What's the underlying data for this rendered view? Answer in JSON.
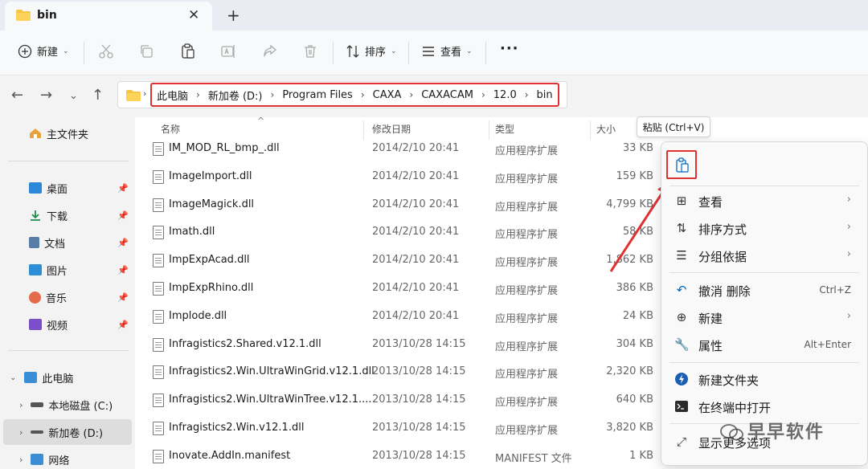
{
  "tab": {
    "title": "bin"
  },
  "toolbar": {
    "new_label": "新建",
    "sort_label": "排序",
    "view_label": "查看",
    "more_label": "···"
  },
  "address": {
    "crumbs": [
      "此电脑",
      "新加卷 (D:)",
      "Program Files",
      "CAXA",
      "CAXACAM",
      "12.0",
      "bin"
    ]
  },
  "sidebar": {
    "home": "主文件夹",
    "quick": [
      {
        "label": "桌面",
        "color": "#2b88d8"
      },
      {
        "label": "下载",
        "color": "#1e8f4a"
      },
      {
        "label": "文档",
        "color": "#5a7da8"
      },
      {
        "label": "图片",
        "color": "#2e8fd9"
      },
      {
        "label": "音乐",
        "color": "#e36b4a"
      },
      {
        "label": "视频",
        "color": "#7b4fc9"
      }
    ],
    "this_pc": "此电脑",
    "drives": [
      "本地磁盘 (C:)",
      "新加卷 (D:)"
    ],
    "network": "网络"
  },
  "columns": {
    "name": "名称",
    "date": "修改日期",
    "type": "类型",
    "size": "大小"
  },
  "files": [
    {
      "name": "IM_MOD_RL_bmp_.dll",
      "date": "2014/2/10 20:41",
      "type": "应用程序扩展",
      "size": "33 KB"
    },
    {
      "name": "ImageImport.dll",
      "date": "2014/2/10 20:41",
      "type": "应用程序扩展",
      "size": "159 KB"
    },
    {
      "name": "ImageMagick.dll",
      "date": "2014/2/10 20:41",
      "type": "应用程序扩展",
      "size": "4,799 KB"
    },
    {
      "name": "Imath.dll",
      "date": "2014/2/10 20:41",
      "type": "应用程序扩展",
      "size": "58 KB"
    },
    {
      "name": "ImpExpAcad.dll",
      "date": "2014/2/10 20:41",
      "type": "应用程序扩展",
      "size": "1,862 KB"
    },
    {
      "name": "ImpExpRhino.dll",
      "date": "2014/2/10 20:41",
      "type": "应用程序扩展",
      "size": "386 KB"
    },
    {
      "name": "Implode.dll",
      "date": "2014/2/10 20:41",
      "type": "应用程序扩展",
      "size": "24 KB"
    },
    {
      "name": "Infragistics2.Shared.v12.1.dll",
      "date": "2013/10/28 14:15",
      "type": "应用程序扩展",
      "size": "304 KB"
    },
    {
      "name": "Infragistics2.Win.UltraWinGrid.v12.1.dll",
      "date": "2013/10/28 14:15",
      "type": "应用程序扩展",
      "size": "2,320 KB"
    },
    {
      "name": "Infragistics2.Win.UltraWinTree.v12.1....",
      "date": "2013/10/28 14:15",
      "type": "应用程序扩展",
      "size": "640 KB"
    },
    {
      "name": "Infragistics2.Win.v12.1.dll",
      "date": "2013/10/28 14:15",
      "type": "应用程序扩展",
      "size": "3,820 KB"
    },
    {
      "name": "Inovate.AddIn.manifest",
      "date": "2013/10/28 14:15",
      "type": "MANIFEST 文件",
      "size": "1 KB"
    }
  ],
  "tooltip": {
    "text": "粘贴 (Ctrl+V)"
  },
  "context_menu": {
    "items": [
      {
        "label": "查看",
        "icon": "grid-icon",
        "arrow": "›",
        "shortcut": ""
      },
      {
        "label": "排序方式",
        "icon": "sort-icon",
        "arrow": "›",
        "shortcut": ""
      },
      {
        "label": "分组依据",
        "icon": "group-icon",
        "arrow": "›",
        "shortcut": ""
      },
      {
        "label": "撤消 删除",
        "icon": "undo-icon",
        "arrow": "",
        "shortcut": "Ctrl+Z"
      },
      {
        "label": "新建",
        "icon": "plus-circle-icon",
        "arrow": "›",
        "shortcut": ""
      },
      {
        "label": "属性",
        "icon": "wrench-icon",
        "arrow": "",
        "shortcut": "Alt+Enter"
      },
      {
        "label": "新建文件夹",
        "icon": "new-folder-icon",
        "arrow": "",
        "shortcut": ""
      },
      {
        "label": "在终端中打开",
        "icon": "terminal-icon",
        "arrow": "",
        "shortcut": ""
      },
      {
        "label": "显示更多选项",
        "icon": "expand-icon",
        "arrow": "",
        "shortcut": ""
      }
    ]
  },
  "watermark": {
    "text": "早早软件"
  },
  "colors": {
    "highlight": "#e03131",
    "folder": "#f5c543",
    "accent": "#0067c0"
  }
}
